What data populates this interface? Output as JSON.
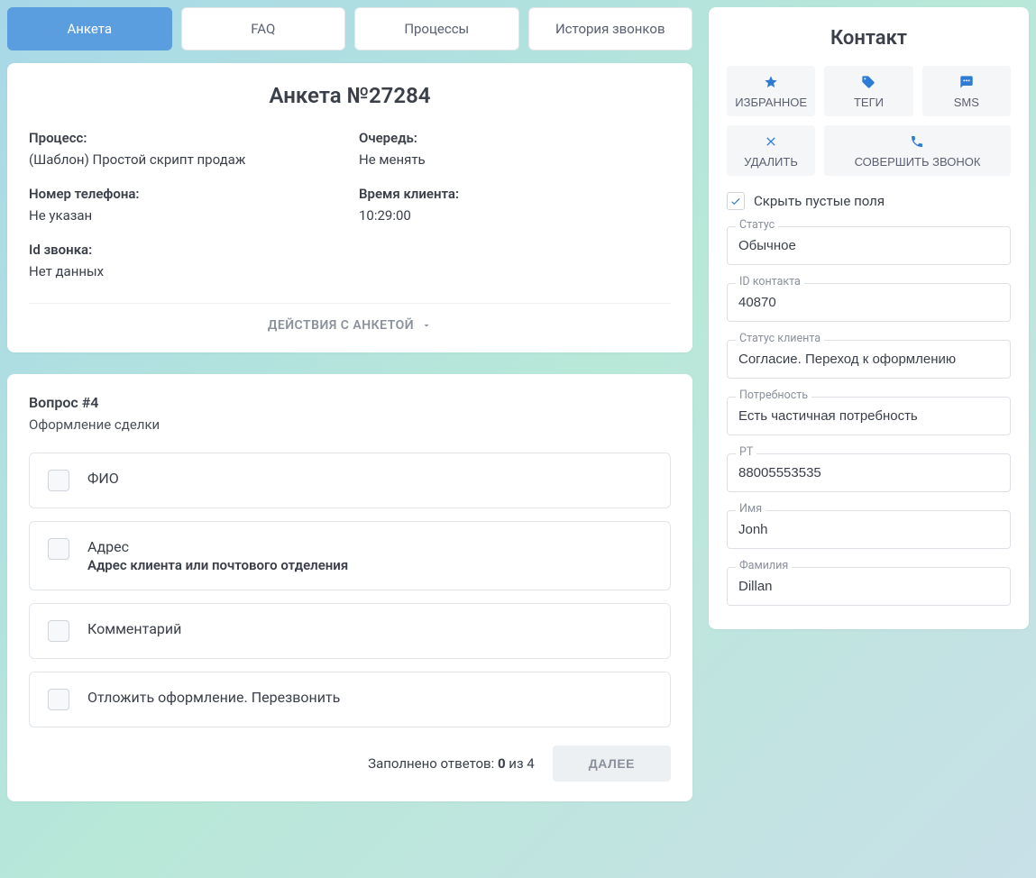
{
  "tabs": [
    {
      "label": "Анкета",
      "active": true
    },
    {
      "label": "FAQ",
      "active": false
    },
    {
      "label": "Процессы",
      "active": false
    },
    {
      "label": "История звонков",
      "active": false
    }
  ],
  "anketa": {
    "title": "Анкета №27284",
    "process_label": "Процесс:",
    "process_value": "(Шаблон) Простой скрипт продаж",
    "queue_label": "Очередь:",
    "queue_value": "Не менять",
    "phone_label": "Номер телефона:",
    "phone_value": "Не указан",
    "client_time_label": "Время клиента:",
    "client_time_value": "10:29:00",
    "call_id_label": "Id звонка:",
    "call_id_value": "Нет данных",
    "actions_label": "ДЕЙСТВИЯ С АНКЕТОЙ"
  },
  "question": {
    "header": "Вопрос #4",
    "subtitle": "Оформление сделки",
    "options": [
      {
        "label": "ФИО",
        "hint": ""
      },
      {
        "label": "Адрес",
        "hint": "Адрес клиента или почтового отделения"
      },
      {
        "label": "Комментарий",
        "hint": ""
      },
      {
        "label": "Отложить оформление. Перезвонить",
        "hint": ""
      }
    ],
    "filled_prefix": "Заполнено ответов: ",
    "filled_count": "0",
    "filled_suffix": " из 4",
    "next_label": "ДАЛЕЕ"
  },
  "contact": {
    "title": "Контакт",
    "actions": {
      "favorite": "ИЗБРАННОЕ",
      "tags": "ТЕГИ",
      "sms": "SMS",
      "delete": "УДАЛИТЬ",
      "call": "СОВЕРШИТЬ ЗВОНОК"
    },
    "hide_empty_label": "Скрыть пустые поля",
    "hide_empty_checked": true,
    "fields": {
      "status": {
        "label": "Статус",
        "value": "Обычное"
      },
      "contact_id": {
        "label": "ID контакта",
        "value": "40870"
      },
      "client_status": {
        "label": "Статус клиента",
        "value": "Согласие. Переход к оформлению"
      },
      "need": {
        "label": "Потребность",
        "value": "Есть частичная потребность"
      },
      "rt": {
        "label": "РТ",
        "value": "88005553535"
      },
      "name": {
        "label": "Имя",
        "value": "Jonh"
      },
      "surname": {
        "label": "Фамилия",
        "value": "Dillan"
      }
    }
  }
}
